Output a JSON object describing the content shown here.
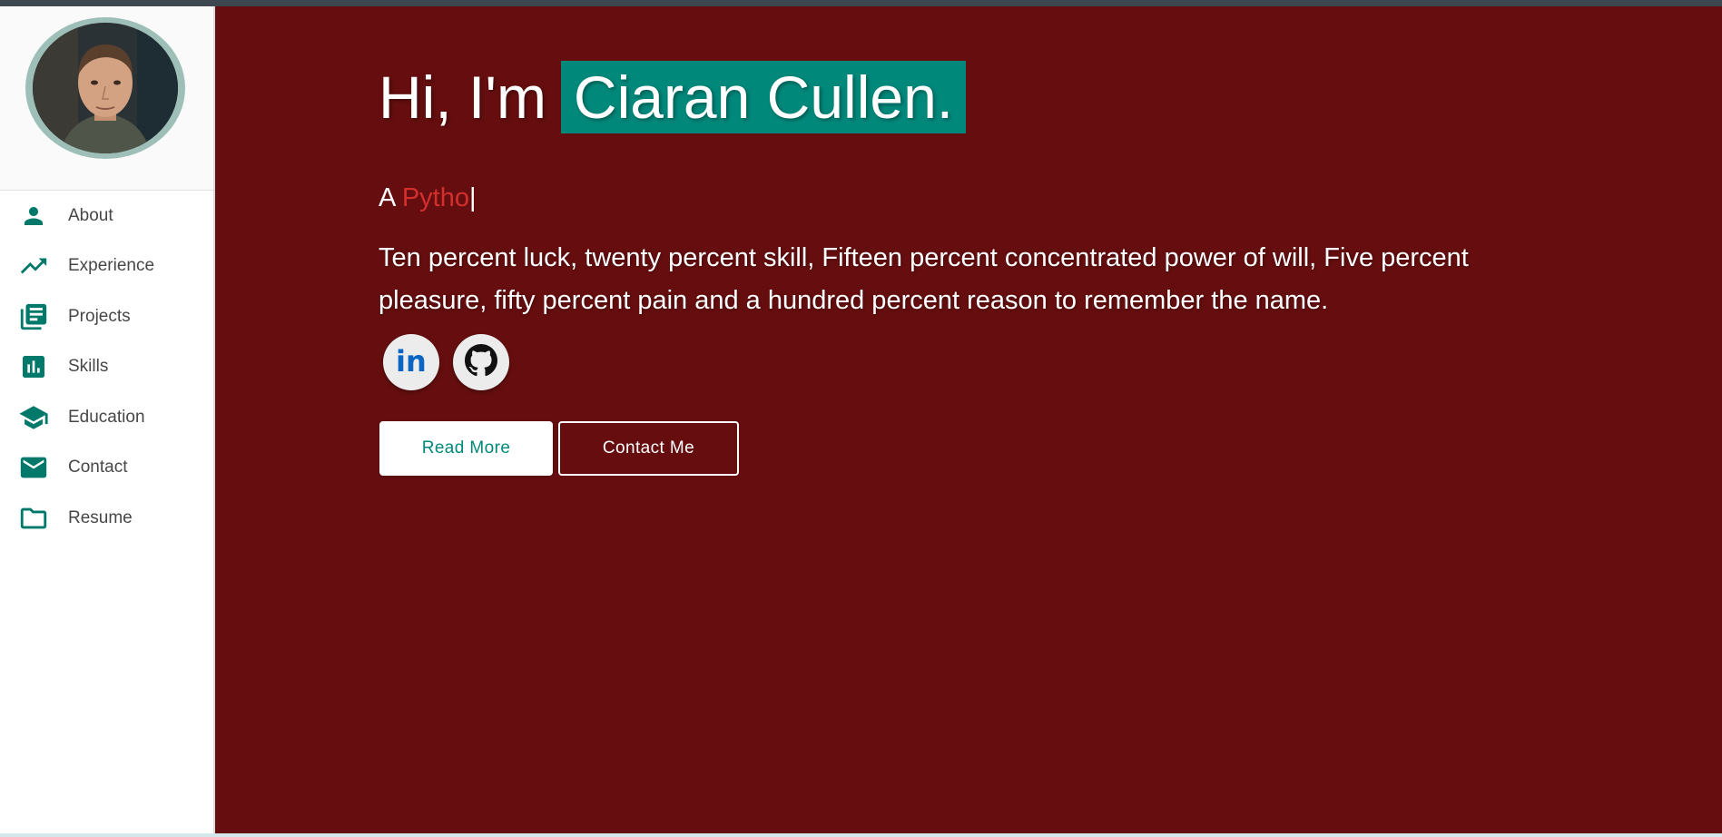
{
  "sidebar": {
    "items": [
      {
        "label": "About",
        "icon": "person-icon"
      },
      {
        "label": "Experience",
        "icon": "trending-up-icon"
      },
      {
        "label": "Projects",
        "icon": "library-books-icon"
      },
      {
        "label": "Skills",
        "icon": "bar-chart-icon"
      },
      {
        "label": "Education",
        "icon": "graduation-cap-icon"
      },
      {
        "label": "Contact",
        "icon": "mail-icon"
      },
      {
        "label": "Resume",
        "icon": "folder-icon"
      }
    ]
  },
  "hero": {
    "greeting": "Hi, I'm",
    "name": "Ciaran Cullen.",
    "typed_prefix": "A",
    "typed_text": "Pytho",
    "typed_cursor": "|",
    "quote": "Ten percent luck, twenty percent skill, Fifteen percent concentrated power of will, Five percent pleasure, fifty percent pain and a hundred percent reason to remember the name."
  },
  "social": [
    {
      "icon": "linkedin-icon",
      "text": "in"
    },
    {
      "icon": "github-icon"
    }
  ],
  "buttons": {
    "read_more": "Read More",
    "contact_me": "Contact Me"
  },
  "colors": {
    "accent": "#00897b",
    "background": "#660e0f",
    "typed_accent": "#d32f2f",
    "icon": "#00796b"
  }
}
